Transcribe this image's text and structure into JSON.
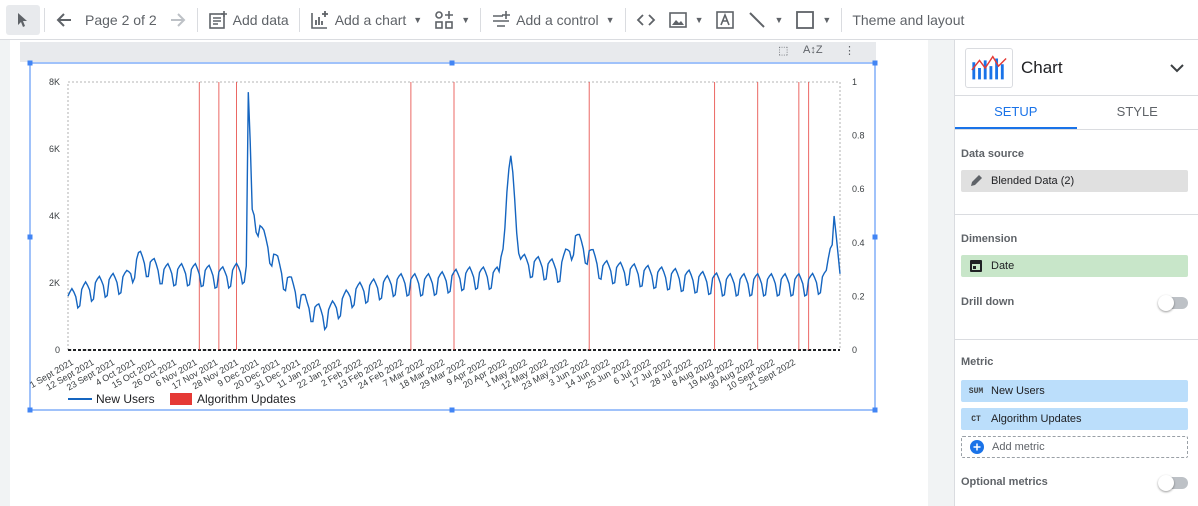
{
  "toolbar": {
    "page_label": "Page 2 of 2",
    "add_data": "Add data",
    "add_chart": "Add a chart",
    "add_control": "Add a control",
    "theme": "Theme and layout"
  },
  "panel": {
    "title": "Chart",
    "tabs": [
      "SETUP",
      "STYLE"
    ],
    "data_source_label": "Data source",
    "data_source_value": "Blended Data (2)",
    "dimension_label": "Dimension",
    "dimension_value": "Date",
    "drill_down_label": "Drill down",
    "metric_label": "Metric",
    "metrics": [
      {
        "tag": "SUM",
        "name": "New Users"
      },
      {
        "tag": "CT",
        "name": "Algorithm Updates"
      }
    ],
    "add_metric": "Add metric",
    "optional_metrics_label": "Optional metrics"
  },
  "colors": {
    "accent": "#1a73e8",
    "series": "#1565c0",
    "updates": "#e53935",
    "source_chip": "#e0e0e0",
    "dimension_chip": "#c8e6c9",
    "metric_chip": "#bbdefb"
  },
  "chart_data": {
    "type": "line",
    "ylim": [
      0,
      8000
    ],
    "y_ticks": [
      "0",
      "2K",
      "4K",
      "6K",
      "8K"
    ],
    "y2lim": [
      0,
      1
    ],
    "y2_ticks": [
      "0",
      "0.2",
      "0.4",
      "0.6",
      "0.8",
      "1"
    ],
    "x_range": [
      "2021-09-01",
      "2022-09-30"
    ],
    "x_ticks": [
      "1 Sept 2021",
      "12 Sept 2021",
      "23 Sept 2021",
      "4 Oct 2021",
      "15 Oct 2021",
      "26 Oct 2021",
      "6 Nov 2021",
      "17 Nov 2021",
      "28 Nov 2021",
      "9 Dec 2021",
      "20 Dec 2021",
      "31 Dec 2021",
      "11 Jan 2022",
      "22 Jan 2022",
      "2 Feb 2022",
      "13 Feb 2022",
      "24 Feb 2022",
      "7 Mar 2022",
      "18 Mar 2022",
      "29 Mar 2022",
      "9 Apr 2022",
      "20 Apr 2022",
      "1 May 2022",
      "12 May 2022",
      "23 May 2022",
      "3 Jun 2022",
      "14 Jun 2022",
      "25 Jun 2022",
      "6 Jul 2022",
      "17 Jul 2022",
      "28 Jul 2022",
      "8 Aug 2022",
      "19 Aug 2022",
      "30 Aug 2022",
      "10 Sept 2022",
      "21 Sept 2022"
    ],
    "series": [
      {
        "name": "New Users",
        "baseline": 1900,
        "weekly_amplitude": 550,
        "points": [
          {
            "x": "2021-09-01",
            "y": 1500
          },
          {
            "x": "2021-09-15",
            "y": 1900
          },
          {
            "x": "2021-10-01",
            "y": 2100
          },
          {
            "x": "2021-10-07",
            "y": 2700
          },
          {
            "x": "2021-10-20",
            "y": 2300
          },
          {
            "x": "2021-11-05",
            "y": 2300
          },
          {
            "x": "2021-11-20",
            "y": 2200
          },
          {
            "x": "2021-12-01",
            "y": 2400
          },
          {
            "x": "2021-12-02",
            "y": 7700
          },
          {
            "x": "2021-12-04",
            "y": 4200
          },
          {
            "x": "2021-12-10",
            "y": 3300
          },
          {
            "x": "2021-12-20",
            "y": 2200
          },
          {
            "x": "2022-01-01",
            "y": 1300
          },
          {
            "x": "2022-01-10",
            "y": 1000
          },
          {
            "x": "2022-01-25",
            "y": 1700
          },
          {
            "x": "2022-02-15",
            "y": 2000
          },
          {
            "x": "2022-03-05",
            "y": 2000
          },
          {
            "x": "2022-03-25",
            "y": 2200
          },
          {
            "x": "2022-04-09",
            "y": 2200
          },
          {
            "x": "2022-04-15",
            "y": 5800
          },
          {
            "x": "2022-04-20",
            "y": 2600
          },
          {
            "x": "2022-05-10",
            "y": 2400
          },
          {
            "x": "2022-05-18",
            "y": 3300
          },
          {
            "x": "2022-06-01",
            "y": 2400
          },
          {
            "x": "2022-07-01",
            "y": 2200
          },
          {
            "x": "2022-08-01",
            "y": 2000
          },
          {
            "x": "2022-08-25",
            "y": 2000
          },
          {
            "x": "2022-09-15",
            "y": 2000
          },
          {
            "x": "2022-09-23",
            "y": 2100
          },
          {
            "x": "2022-09-27",
            "y": 4000
          },
          {
            "x": "2022-09-30",
            "y": 2000
          }
        ]
      },
      {
        "name": "Algorithm Updates",
        "type": "vertical-lines",
        "dates": [
          "2021-11-07",
          "2021-11-17",
          "2021-11-26",
          "2022-02-23",
          "2022-03-17",
          "2022-05-25",
          "2022-07-28",
          "2022-08-19",
          "2022-09-09",
          "2022-09-14"
        ]
      }
    ],
    "legend": [
      "New Users",
      "Algorithm Updates"
    ],
    "legend_position": "bottom-left"
  }
}
